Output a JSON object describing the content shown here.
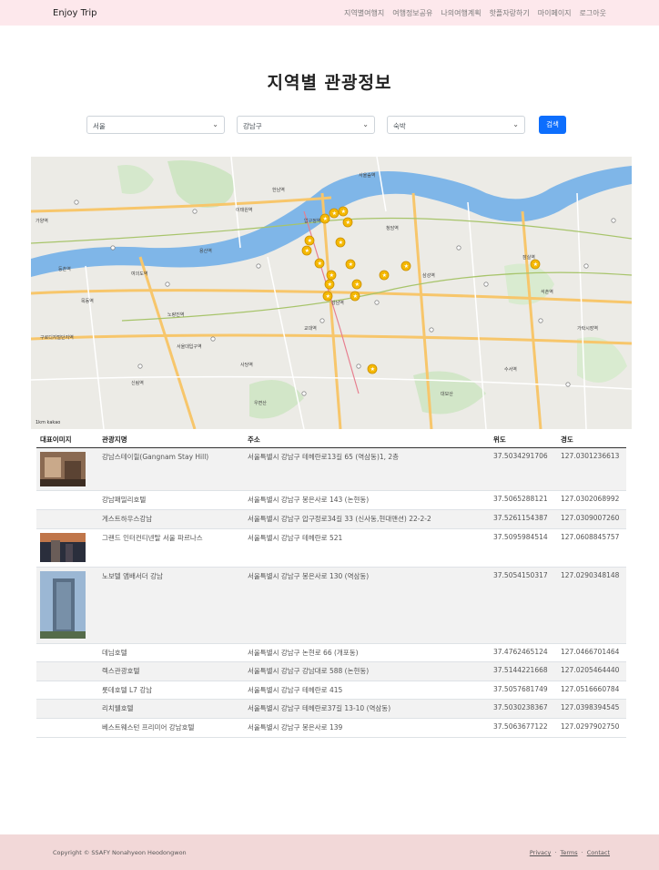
{
  "navbar": {
    "brand": "Enjoy Trip",
    "links": [
      "지역별여행지",
      "여행정보공유",
      "나의여행계획",
      "핫플자랑하기",
      "마이페이지",
      "로그아웃"
    ]
  },
  "page_title": "지역별 관광정보",
  "filters": {
    "region": "서울",
    "district": "강남구",
    "content_type": "숙박",
    "search_label": "검색"
  },
  "map": {
    "scale_label": "1km",
    "provider": "kakao",
    "marker_color": "#f5b800",
    "labels": [
      "가양역",
      "등촌역",
      "목동역",
      "여의도역",
      "노량진역",
      "용산역",
      "이태원역",
      "한남역",
      "서울숲역",
      "압구정역",
      "청담역",
      "삼성역",
      "강남역",
      "교대역",
      "사당역",
      "서울대입구역",
      "신림역",
      "구로디지털단지역",
      "잠실역",
      "석촌역",
      "가락시장역",
      "수서역",
      "대모산",
      "우면산"
    ]
  },
  "table": {
    "headers": [
      "대표이미지",
      "관광지명",
      "주소",
      "위도",
      "경도"
    ],
    "rows": [
      {
        "name": "강남스테이힐(Gangnam Stay Hill)",
        "address": "서울특별시 강남구 테헤란로13길 65 (역삼동)1, 2층",
        "lat": "37.5034291706",
        "lng": "127.0301236613"
      },
      {
        "name": "강남패밀리호텔",
        "address": "서울특별시 강남구 봉은사로 143 (논현동)",
        "lat": "37.5065288121",
        "lng": "127.0302068992"
      },
      {
        "name": "게스트하우스강남",
        "address": "서울특별시 강남구 압구정로34길 33 (신사동,현대맨션) 22-2-2",
        "lat": "37.5261154387",
        "lng": "127.0309007260"
      },
      {
        "name": "그랜드 인터컨티넨탈 서울 파르나스",
        "address": "서울특별시 강남구 테헤란로 521",
        "lat": "37.5095984514",
        "lng": "127.0608845757"
      },
      {
        "name": "노보텔 앰배서더 강남",
        "address": "서울특별시 강남구 봉은사로 130 (역삼동)",
        "lat": "37.5054150317",
        "lng": "127.0290348148"
      },
      {
        "name": "데님호텔",
        "address": "서울특별시 강남구 논현로 66 (개포동)",
        "lat": "37.4762465124",
        "lng": "127.0466701464"
      },
      {
        "name": "렉스관광호텔",
        "address": "서울특별시 강남구 강남대로 588 (논현동)",
        "lat": "37.5144221668",
        "lng": "127.0205464440"
      },
      {
        "name": "롯데호텔 L7 강남",
        "address": "서울특별시 강남구 테헤란로 415",
        "lat": "37.5057681749",
        "lng": "127.0516660784"
      },
      {
        "name": "리치웰호텔",
        "address": "서울특별시 강남구 테헤란로37길 13-10 (역삼동)",
        "lat": "37.5030238367",
        "lng": "127.0398394545"
      },
      {
        "name": "베스트웨스턴 프리미어 강남호텔",
        "address": "서울특별시 강남구 봉은사로 139",
        "lat": "37.5063677122",
        "lng": "127.0297902750"
      }
    ]
  },
  "footer": {
    "copyright": "Copyright © SSAFY Nonahyeon Heodongwon",
    "links": [
      "Privacy",
      "Terms",
      "Contact"
    ],
    "separator": "·"
  }
}
